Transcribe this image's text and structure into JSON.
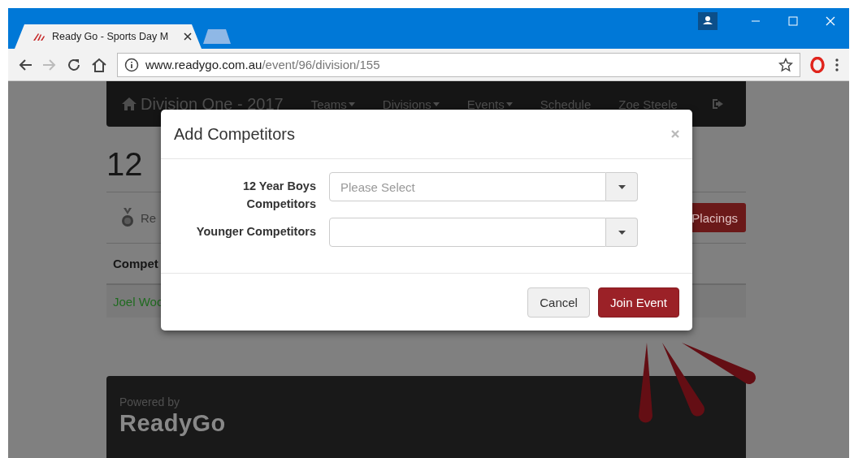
{
  "browser": {
    "tabs": [
      {
        "title": "Ready Go - Sports Day M",
        "selected": true
      }
    ],
    "url": {
      "host": "www.readygo.com.au",
      "path": "/event/96/division/155"
    }
  },
  "page": {
    "navbar": {
      "brand": "Division One - 2017",
      "items": [
        {
          "label": "Teams",
          "dropdown": true
        },
        {
          "label": "Divisions",
          "dropdown": true
        },
        {
          "label": "Events",
          "dropdown": true
        },
        {
          "label": "Schedule",
          "dropdown": false
        },
        {
          "label": "Zoe Steele",
          "dropdown": false
        }
      ]
    },
    "heading": "12",
    "tab_label": "Re",
    "placings_button": "Placings",
    "table": {
      "columns": [
        "Compet"
      ],
      "rows": [
        [
          "Joel Woo"
        ]
      ]
    },
    "footer": {
      "powered_by": "Powered by",
      "logo": "ReadyGo"
    }
  },
  "modal": {
    "title": "Add Competitors",
    "fields": [
      {
        "label": "12 Year Boys Competitors",
        "placeholder": "Please Select"
      },
      {
        "label": "Younger Competitors"
      }
    ],
    "buttons": [
      {
        "label": "Cancel",
        "kind": "default"
      },
      {
        "label": "Join Event",
        "kind": "primary"
      }
    ]
  }
}
